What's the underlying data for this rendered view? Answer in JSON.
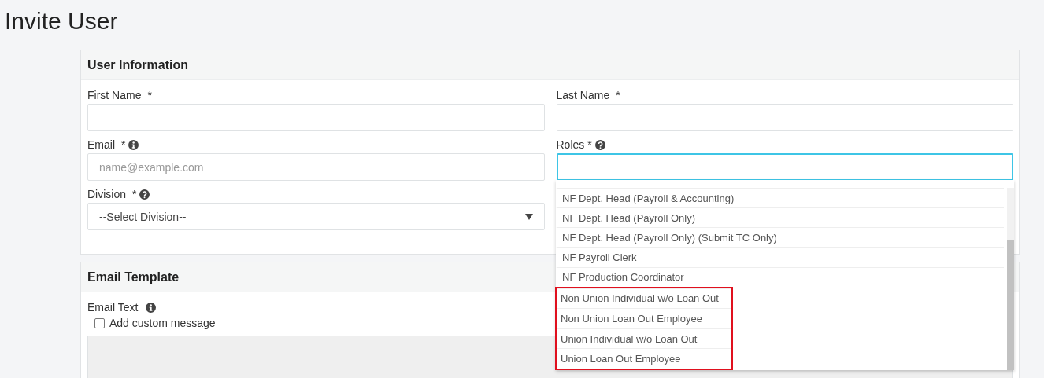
{
  "page": {
    "title": "Invite User"
  },
  "user_information": {
    "title": "User Information",
    "fields": [
      {
        "label": "First Name",
        "required_mark": "*",
        "kind": "text"
      },
      {
        "label": "Last Name",
        "required_mark": "*",
        "kind": "text"
      },
      {
        "label": "Email",
        "required_mark": "*",
        "kind": "text",
        "placeholder": "name@example.com",
        "info_icon": true
      },
      {
        "label": "Roles",
        "required_mark": "*",
        "kind": "text",
        "help_icon": true,
        "focused": true
      },
      {
        "label": "Division",
        "required_mark": "*",
        "kind": "select",
        "value": "--Select Division--",
        "help_icon": true
      }
    ]
  },
  "roles_dropdown": {
    "options": [
      {
        "label": "NF Dept. Head (Payroll & Accounting)",
        "highlighted": false
      },
      {
        "label": "NF Dept. Head (Payroll Only)",
        "highlighted": false
      },
      {
        "label": "NF Dept. Head (Payroll Only) (Submit TC Only)",
        "highlighted": false
      },
      {
        "label": "NF Payroll Clerk",
        "highlighted": false
      },
      {
        "label": "NF Production Coordinator",
        "highlighted": false
      },
      {
        "label": "Non Union Individual w/o Loan Out",
        "highlighted": true
      },
      {
        "label": "Non Union Loan Out Employee",
        "highlighted": true
      },
      {
        "label": "Union Individual w/o Loan Out",
        "highlighted": true
      },
      {
        "label": "Union Loan Out Employee",
        "highlighted": true
      }
    ]
  },
  "email_template": {
    "title": "Email Template",
    "email_text_label": "Email Text",
    "custom_message": {
      "label": "Add custom message",
      "checked": false
    },
    "message_box": {
      "disabled": true
    }
  }
}
